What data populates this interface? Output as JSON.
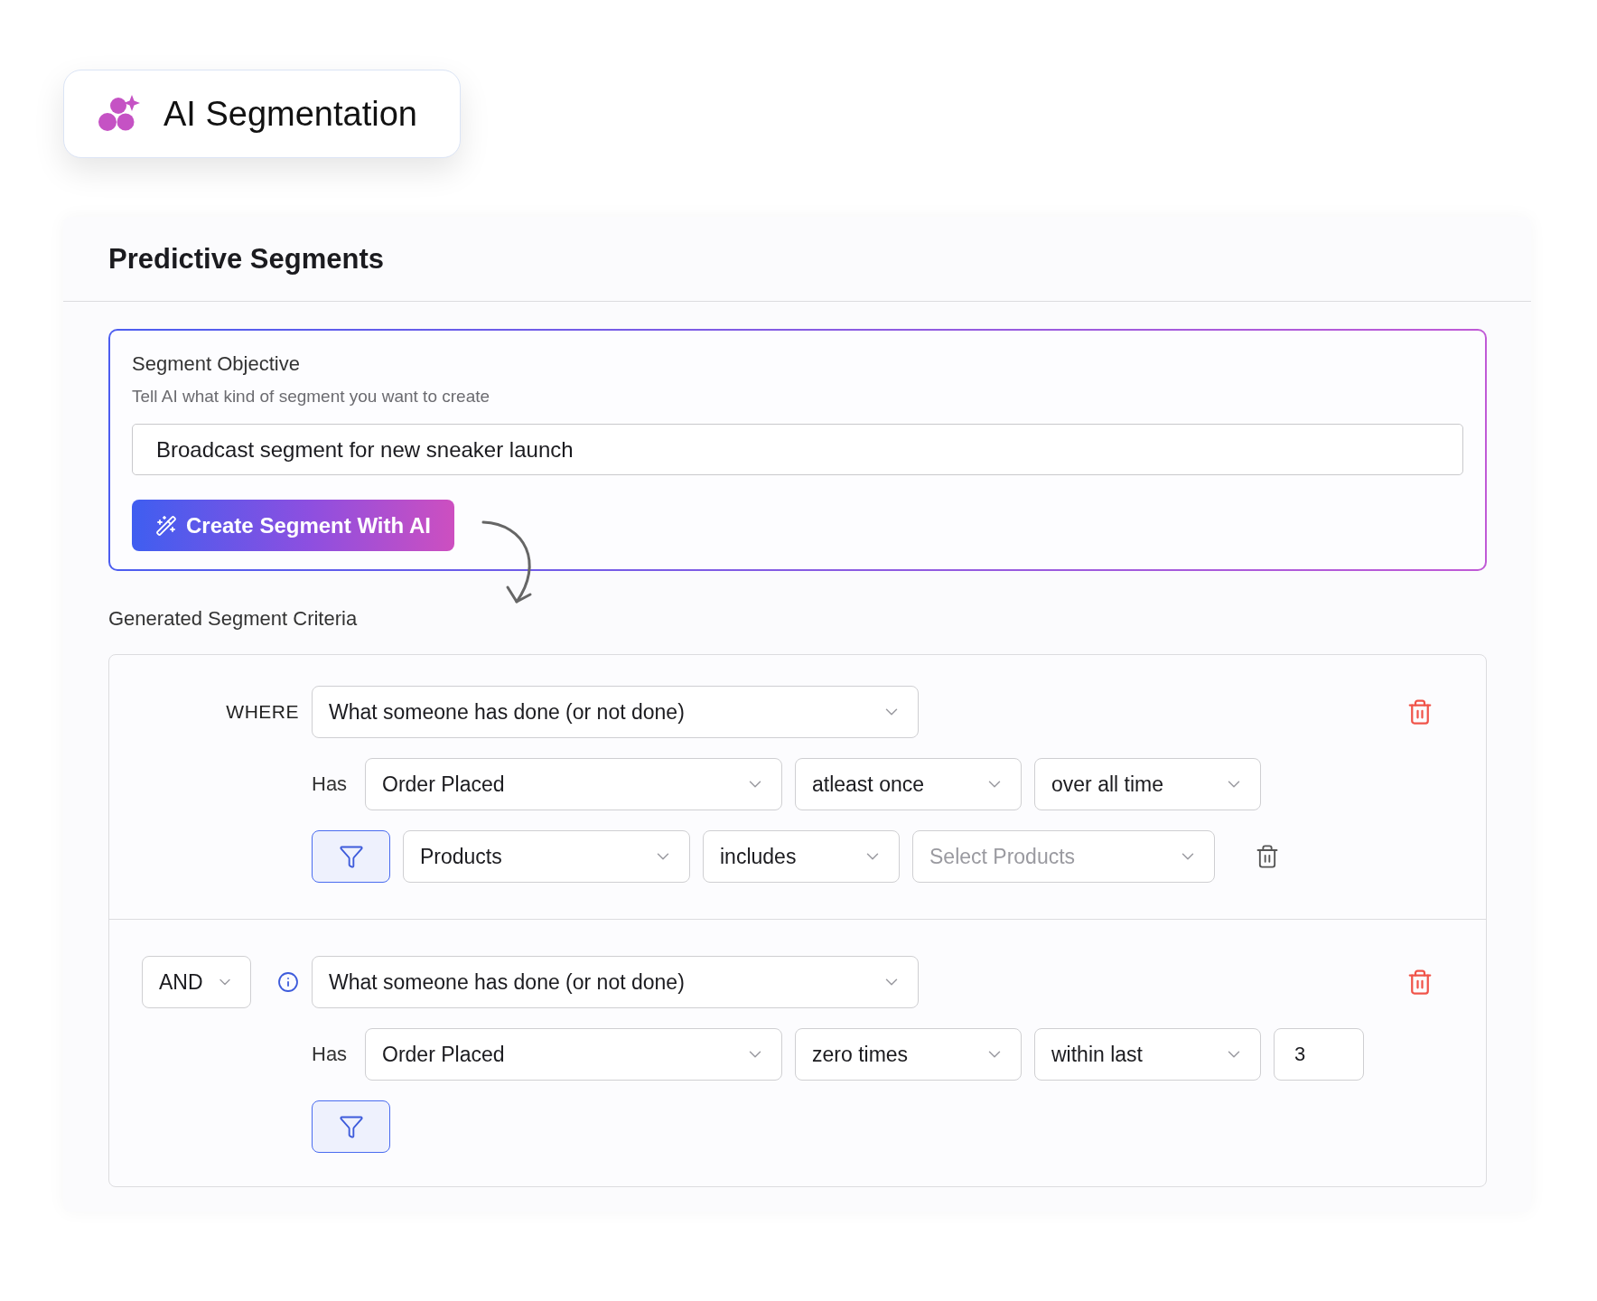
{
  "badge": {
    "title": "AI Segmentation"
  },
  "panel": {
    "title": "Predictive Segments"
  },
  "objective": {
    "title": "Segment Objective",
    "description": "Tell AI what kind of segment you want to create",
    "input": {
      "value": "Broadcast segment for new sneaker launch"
    },
    "button": {
      "label": "Create Segment With AI"
    }
  },
  "criteria": {
    "title": "Generated Segment Criteria",
    "groups": [
      {
        "connector": {
          "kind": "label",
          "text": "WHERE"
        },
        "condition": {
          "value": "What someone has done (or not done)"
        },
        "has_label": "Has",
        "fields": [
          {
            "kind": "select",
            "value": "Order Placed"
          },
          {
            "kind": "select",
            "value": "atleast once"
          },
          {
            "kind": "select",
            "value": "over all time"
          }
        ],
        "filters": [
          {
            "property": "Products",
            "operator": "includes",
            "placeholder": "Select Products"
          }
        ]
      },
      {
        "connector": {
          "kind": "select",
          "text": "AND"
        },
        "condition": {
          "value": "What someone has done (or not done)"
        },
        "has_label": "Has",
        "fields": [
          {
            "kind": "select",
            "value": "Order Placed"
          },
          {
            "kind": "select",
            "value": "zero times"
          },
          {
            "kind": "select",
            "value": "within last"
          },
          {
            "kind": "input",
            "value": "3"
          }
        ]
      }
    ]
  }
}
